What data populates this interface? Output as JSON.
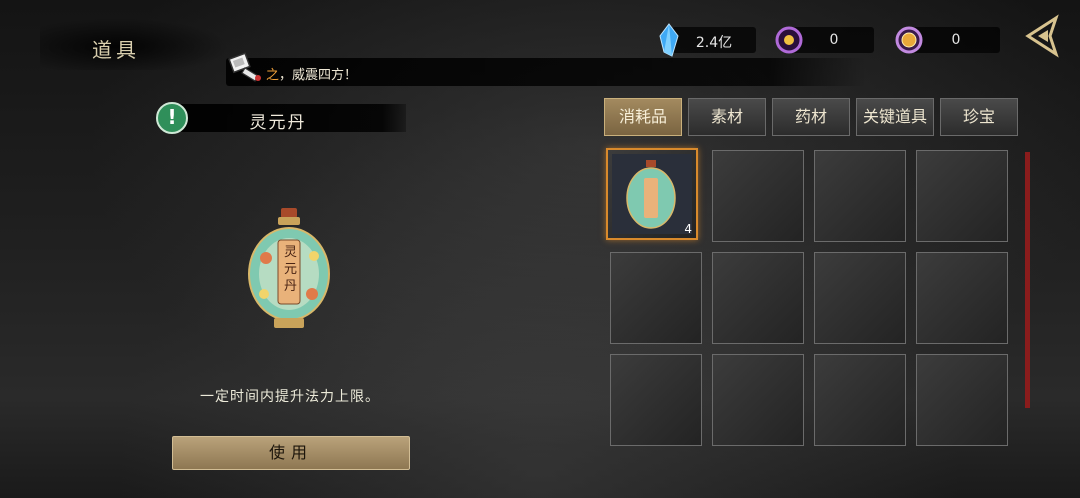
{
  "header": {
    "title": "道具",
    "ticker_highlight": "之",
    "ticker_text": "，威震四方！"
  },
  "currencies": [
    {
      "icon": "crystal-icon",
      "value": "2.4亿"
    },
    {
      "icon": "spirit-orb-icon",
      "value": "0"
    },
    {
      "icon": "gold-coin-icon",
      "value": "0"
    }
  ],
  "detail": {
    "name": "灵元丹",
    "image_label": "灵元丹",
    "description": "一定时间内提升法力上限。",
    "use_label": "使用"
  },
  "tabs": [
    {
      "label": "消耗品",
      "active": true
    },
    {
      "label": "素材",
      "active": false
    },
    {
      "label": "药材",
      "active": false
    },
    {
      "label": "关键道具",
      "active": false
    },
    {
      "label": "珍宝",
      "active": false
    }
  ],
  "inventory": {
    "slots": [
      {
        "item": "灵元丹",
        "count": "4",
        "selected": true
      }
    ]
  },
  "colors": {
    "accent": "#d98a2c",
    "tab_active": "#a38a5f",
    "scrollbar": "#8a1c1c",
    "alert": "#2f8f5a"
  }
}
